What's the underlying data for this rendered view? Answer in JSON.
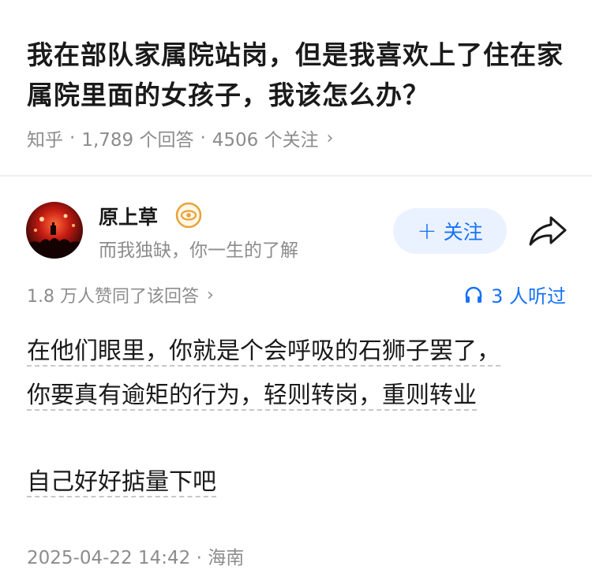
{
  "question": {
    "title": "我在部队家属院站岗，但是我喜欢上了住在家属院里面的女孩子，我该怎么办？",
    "source": "知乎",
    "answer_count": "1,789 个回答",
    "follow_count": "4506 个关注"
  },
  "author": {
    "name": "原上草",
    "bio": "而我独缺，你一生的了解",
    "follow_label": "关注",
    "avatar_icon": "avatar-concert-photo",
    "badge_icon": "eye-badge-icon"
  },
  "answer_meta": {
    "agree_text": "1.8 万人赞同了该回答",
    "listen_text": "3 人听过"
  },
  "answer": {
    "line1": "在他们眼里，你就是个会呼吸的石狮子罢了，",
    "line2": "你要真有逾矩的行为，轻则转岗，重则转业",
    "line3": "自己好好掂量下吧"
  },
  "footer": {
    "date": "2025-04-22 14:42",
    "location": "海南"
  },
  "colors": {
    "accent": "#1772f6",
    "follow_bg": "#ebf2ff",
    "muted": "#8c8c8c",
    "badge": "#e8a23a"
  }
}
